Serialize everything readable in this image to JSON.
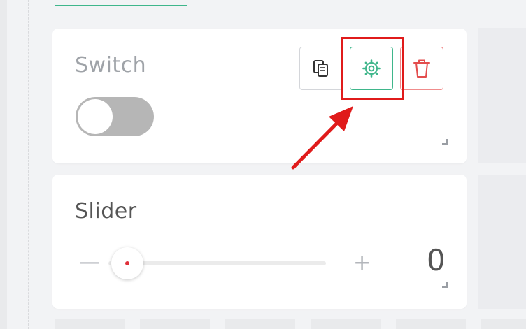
{
  "dashboard": {
    "switch_widget": {
      "title": "Switch",
      "state": "off",
      "actions": {
        "copy_icon": "copy-icon",
        "settings_icon": "gear-icon",
        "delete_icon": "trash-icon"
      }
    },
    "slider_widget": {
      "title": "Slider",
      "decrement_label": "—",
      "increment_label": "+",
      "value": "0"
    }
  },
  "annotation": {
    "highlight_color": "#e01b1b",
    "target": "settings-button"
  },
  "colors": {
    "accent": "#3fb68b",
    "danger": "#f08c8c",
    "toggle_off": "#b6b6b6",
    "slider_dot": "#e0303a",
    "title_gray": "#9fa3a8",
    "title_dark": "#555555"
  }
}
